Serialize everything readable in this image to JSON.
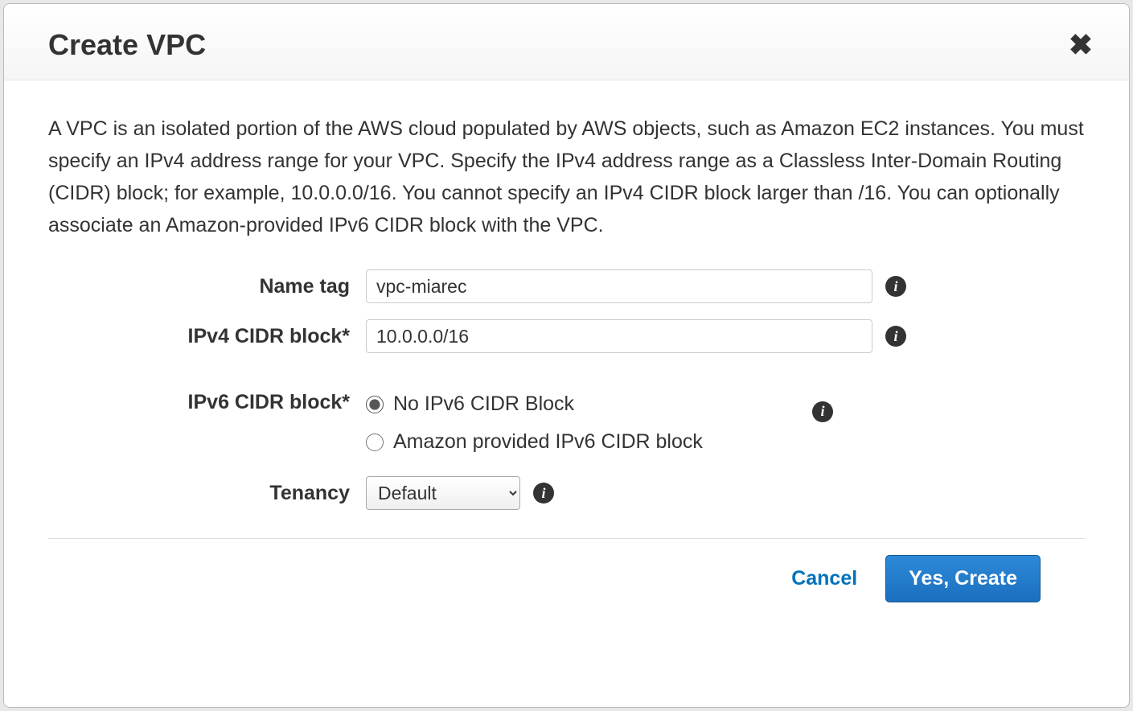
{
  "header": {
    "title": "Create VPC"
  },
  "description": "A VPC is an isolated portion of the AWS cloud populated by AWS objects, such as Amazon EC2 instances. You must specify an IPv4 address range for your VPC. Specify the IPv4 address range as a Classless Inter-Domain Routing (CIDR) block; for example, 10.0.0.0/16. You cannot specify an IPv4 CIDR block larger than /16. You can optionally associate an Amazon-provided IPv6 CIDR block with the VPC.",
  "form": {
    "name_tag": {
      "label": "Name tag",
      "value": "vpc-miarec"
    },
    "ipv4_cidr": {
      "label": "IPv4 CIDR block*",
      "value": "10.0.0.0/16"
    },
    "ipv6_cidr": {
      "label": "IPv6 CIDR block*",
      "options": {
        "none": "No IPv6 CIDR Block",
        "amazon": "Amazon provided IPv6 CIDR block"
      },
      "selected": "none"
    },
    "tenancy": {
      "label": "Tenancy",
      "value": "Default"
    }
  },
  "footer": {
    "cancel": "Cancel",
    "submit": "Yes, Create"
  }
}
